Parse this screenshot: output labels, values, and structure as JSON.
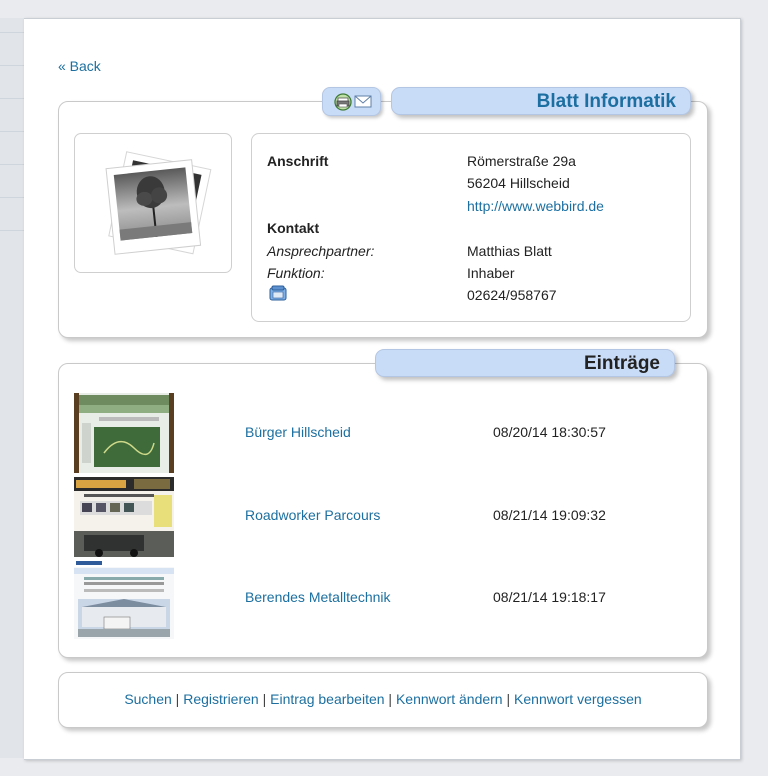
{
  "back_label": "« Back",
  "company": {
    "name": "Blatt Informatik",
    "address_heading": "Anschrift",
    "street": "Römerstraße 29a",
    "city": "56204 Hillscheid",
    "website": "http://www.webbird.de",
    "contact_heading": "Kontakt",
    "contact_person_label": "Ansprechpartner:",
    "contact_person": "Matthias Blatt",
    "function_label": "Funktion:",
    "function": "Inhaber",
    "phone": "02624/958767"
  },
  "icons": [
    "print-icon",
    "email-icon",
    "phone-icon"
  ],
  "entries_title": "Einträge",
  "entries": [
    {
      "name": "Bürger Hillscheid",
      "date": "08/20/14 18:30:57"
    },
    {
      "name": "Roadworker Parcours",
      "date": "08/21/14 19:09:32"
    },
    {
      "name": "Berendes Metalltechnik",
      "date": "08/21/14 19:18:17"
    }
  ],
  "footer": {
    "links": [
      "Suchen",
      "Registrieren",
      "Eintrag bearbeiten",
      "Kennwort ändern",
      "Kennwort vergessen"
    ],
    "separator": " | "
  },
  "colors": {
    "accent": "#1c6fa0",
    "tab_bg": "#c9dcf7"
  }
}
